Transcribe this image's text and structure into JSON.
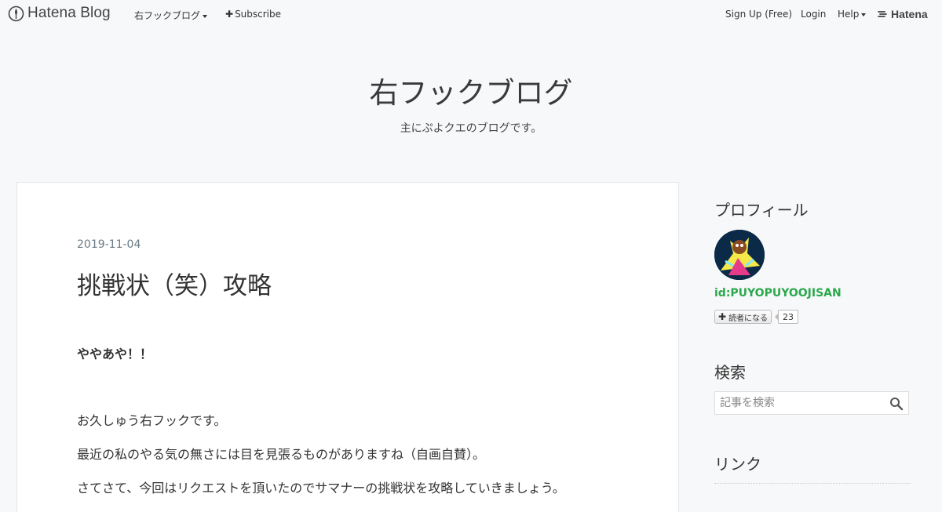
{
  "global_bar": {
    "logo_text": "Hatena Blog",
    "blog_menu_label": "右フックブログ",
    "subscribe_label": "Subscribe",
    "signup_label": "Sign Up (Free)",
    "login_label": "Login",
    "help_label": "Help",
    "hatena_label": "Hatena"
  },
  "blog": {
    "title": "右フックブログ",
    "description": "主にぷよクエのブログです。"
  },
  "entry": {
    "date": "2019-11-04",
    "title": "挑戦状（笑）攻略",
    "paragraphs": [
      "ややあや！！",
      "お久しゅう右フックです。",
      "最近の私のやる気の無さには目を見張るものがありますね（自画自賛）。",
      "さてさて、今回はリクエストを頂いたのでサマナーの挑戦状を攻略していきましょう。"
    ]
  },
  "sidebar": {
    "profile_heading": "プロフィール",
    "profile_id": "id:PUYOPUYOOJISAN",
    "subscribe_button_label": "読者になる",
    "subscriber_count": "23",
    "search_heading": "検索",
    "search_placeholder": "記事を検索",
    "links_heading": "リンク"
  }
}
